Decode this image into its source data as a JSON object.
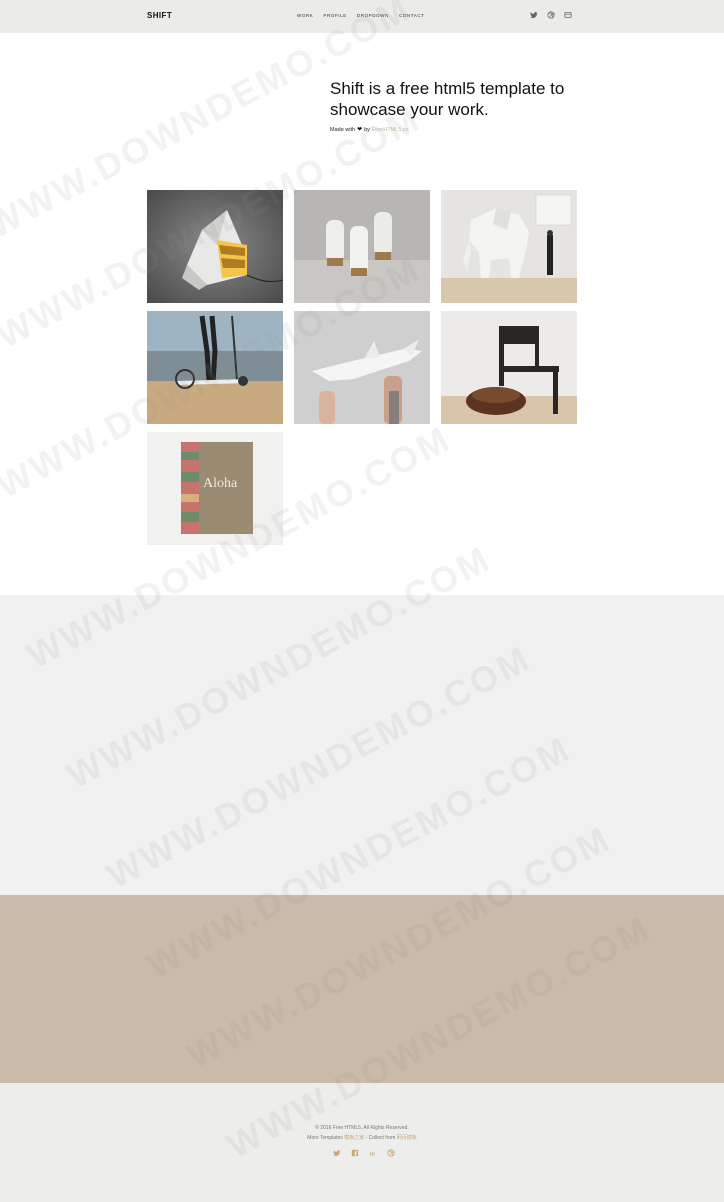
{
  "header": {
    "logo": "SHIFT",
    "nav": [
      "WORK",
      "PROFILE",
      "DROPDOWN",
      "CONTACT"
    ],
    "social_icons": [
      "twitter-icon",
      "dribbble-icon",
      "github-icon"
    ]
  },
  "intro": {
    "title": "Shift is a free html5 template to showcase your work.",
    "made_with": "Made with",
    "by": "by",
    "link": "FreeHTML5.co"
  },
  "gallery": [
    {
      "subject": "folded paper lamp"
    },
    {
      "subject": "salt and pepper shakers"
    },
    {
      "subject": "origami elephant"
    },
    {
      "subject": "kick scooter"
    },
    {
      "subject": "paper shark"
    },
    {
      "subject": "chair with leather bag"
    },
    {
      "subject": "Aloha book",
      "cover_text": "Aloha"
    }
  ],
  "footer": {
    "copyright": "© 2016 Free HTML5. All Rights Reserved.",
    "more_templates": "More Templates",
    "link1": "模板之家",
    "collect_from": "- Collect from",
    "link2": "网页模板",
    "social_icons": [
      "twitter-icon",
      "facebook-icon",
      "linkedin-icon",
      "dribbble-icon"
    ]
  },
  "watermark": "WWW.DOWNDEMO.COM",
  "colors": {
    "header_bg": "#ebebea",
    "grey_band": "#f1f1f1",
    "tan_band": "#c9baa9",
    "footer_bg": "#ededec",
    "accent": "#c9b9a8"
  }
}
